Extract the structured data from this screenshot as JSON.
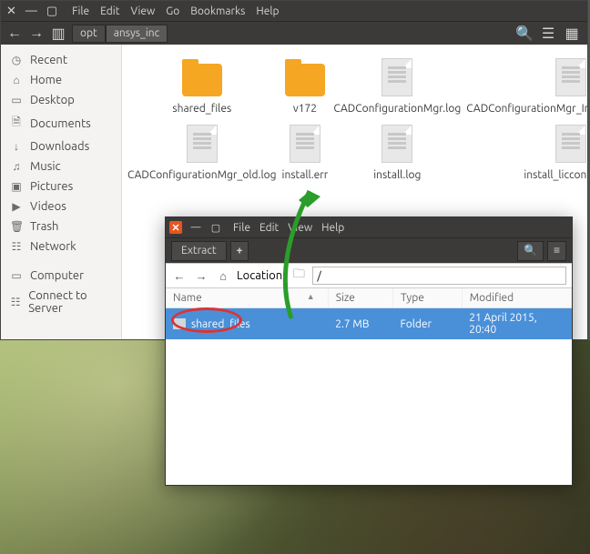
{
  "fm": {
    "menu": [
      "File",
      "Edit",
      "View",
      "Go",
      "Bookmarks",
      "Help"
    ],
    "breadcrumb": [
      "opt",
      "ansys_inc"
    ],
    "sidebar": [
      {
        "icon": "◷",
        "label": "Recent"
      },
      {
        "icon": "⌂",
        "label": "Home"
      },
      {
        "icon": "▭",
        "label": "Desktop"
      },
      {
        "icon": "🗎",
        "label": "Documents"
      },
      {
        "icon": "↓",
        "label": "Downloads"
      },
      {
        "icon": "♫",
        "label": "Music"
      },
      {
        "icon": "▣",
        "label": "Pictures"
      },
      {
        "icon": "▶",
        "label": "Videos"
      },
      {
        "icon": "🗑",
        "label": "Trash"
      },
      {
        "icon": "☷",
        "label": "Network"
      }
    ],
    "sidebar2": [
      {
        "icon": "▭",
        "label": "Computer"
      },
      {
        "icon": "☷",
        "label": "Connect to Server"
      }
    ],
    "items_row1": [
      {
        "kind": "folder",
        "name": "shared_files"
      },
      {
        "kind": "folder",
        "name": "v172"
      },
      {
        "kind": "file",
        "name": "CADConfigurationMgr.log"
      },
      {
        "kind": "file",
        "name": "CADConfigurationMgr_InputArguments.l..."
      }
    ],
    "items_row2": [
      {
        "kind": "file",
        "name": "CADConfigurationMgr_old.log"
      },
      {
        "kind": "file",
        "name": "install.err"
      },
      {
        "kind": "file",
        "name": "install.log"
      },
      {
        "kind": "file",
        "name": "install_licconfig.log"
      }
    ]
  },
  "am": {
    "menu": [
      "File",
      "Edit",
      "View",
      "Help"
    ],
    "extract_label": "Extract",
    "plus_label": "+",
    "location_label": "Location:",
    "location_value": "/",
    "cols": {
      "name": "Name",
      "size": "Size",
      "type": "Type",
      "modified": "Modified"
    },
    "rows": [
      {
        "name": "shared_files",
        "size": "2.7 MB",
        "type": "Folder",
        "modified": "21 April 2015, 20:40"
      }
    ]
  }
}
